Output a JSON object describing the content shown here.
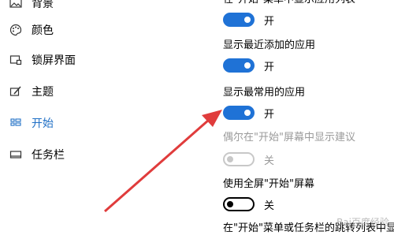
{
  "sidebar": {
    "items": [
      {
        "label": "背景",
        "icon": "picture-icon"
      },
      {
        "label": "颜色",
        "icon": "palette-icon"
      },
      {
        "label": "锁屏界面",
        "icon": "lock-screen-icon"
      },
      {
        "label": "主题",
        "icon": "brush-icon"
      },
      {
        "label": "开始",
        "icon": "start-icon",
        "active": true
      },
      {
        "label": "任务栏",
        "icon": "taskbar-icon"
      }
    ]
  },
  "settings": [
    {
      "label": "在\"开始\"菜单中显示应用列表",
      "state": "开",
      "value": true
    },
    {
      "label": "显示最近添加的应用",
      "state": "开",
      "value": true
    },
    {
      "label": "显示最常用的应用",
      "state": "开",
      "value": true
    },
    {
      "label": "偶尔在\"开始\"屏幕中显示建议",
      "state": "关",
      "value": false,
      "disabled": true
    },
    {
      "label": "使用全屏\"开始\"屏幕",
      "state": "关",
      "value": false
    },
    {
      "label": "在\"开始\"菜单或任务栏的跳转列表中显示"
    }
  ],
  "annotation": {
    "arrow_color": "#e03c3c"
  },
  "watermark": {
    "text": "Bai百度经验"
  },
  "colors": {
    "accent": "#1f72d6"
  }
}
